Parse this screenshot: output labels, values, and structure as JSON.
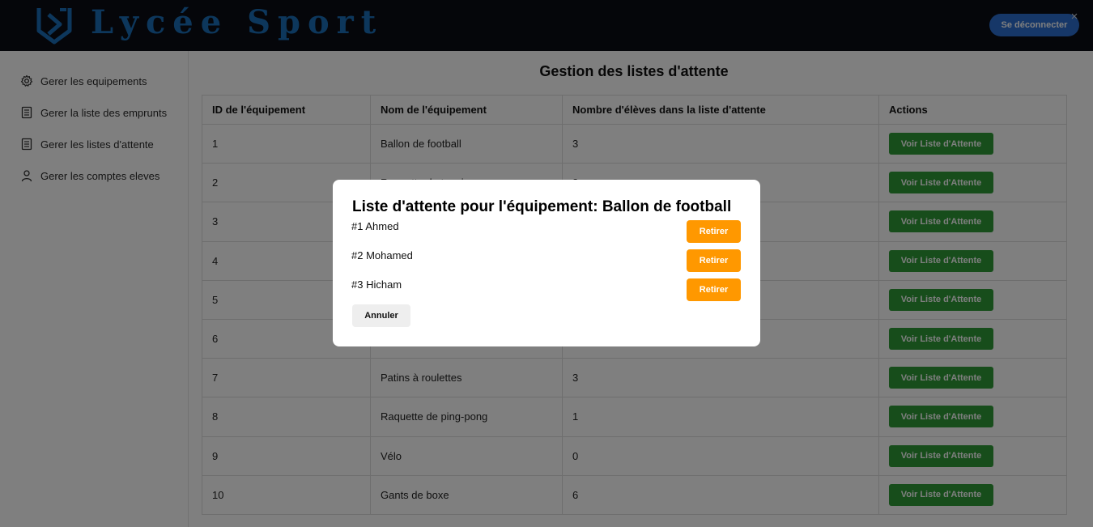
{
  "header": {
    "brand": "Lycée Sport",
    "logout_label": "Se déconnecter",
    "close_glyph": "×"
  },
  "sidebar": {
    "items": [
      {
        "label": "Gerer les equipements",
        "icon": "gear-icon"
      },
      {
        "label": "Gerer la liste des emprunts",
        "icon": "list-document-icon"
      },
      {
        "label": "Gerer les listes d'attente",
        "icon": "list-document-icon"
      },
      {
        "label": "Gerer les comptes eleves",
        "icon": "user-icon"
      }
    ]
  },
  "main": {
    "title": "Gestion des listes d'attente",
    "table": {
      "columns": [
        "ID de l'équipement",
        "Nom de l'équipement",
        "Nombre d'élèves dans la liste d'attente",
        "Actions"
      ],
      "action_label": "Voir Liste d'Attente",
      "rows": [
        {
          "id": "1",
          "name": "Ballon de football",
          "count": "3"
        },
        {
          "id": "2",
          "name": "Raquette de tennis",
          "count": "2"
        },
        {
          "id": "3",
          "name": "",
          "count": ""
        },
        {
          "id": "4",
          "name": "",
          "count": ""
        },
        {
          "id": "5",
          "name": "",
          "count": ""
        },
        {
          "id": "6",
          "name": "",
          "count": ""
        },
        {
          "id": "7",
          "name": "Patins à roulettes",
          "count": "3"
        },
        {
          "id": "8",
          "name": "Raquette de ping-pong",
          "count": "1"
        },
        {
          "id": "9",
          "name": "Vélo",
          "count": "0"
        },
        {
          "id": "10",
          "name": "Gants de boxe",
          "count": "6"
        }
      ]
    }
  },
  "modal": {
    "title": "Liste d'attente pour l'équipement: Ballon de football",
    "entries": [
      {
        "label": "#1 Ahmed"
      },
      {
        "label": "#2 Mohamed"
      },
      {
        "label": "#3 Hicham"
      }
    ],
    "remove_label": "Retirer",
    "cancel_label": "Annuler"
  },
  "colors": {
    "header_bg": "#0b0d14",
    "brand": "#1b6fb8",
    "logout_bg": "#2d6fd1",
    "action_green": "#2e9a36",
    "remove_orange": "#ff9800",
    "overlay": "rgba(0,0,0,0.5)"
  }
}
